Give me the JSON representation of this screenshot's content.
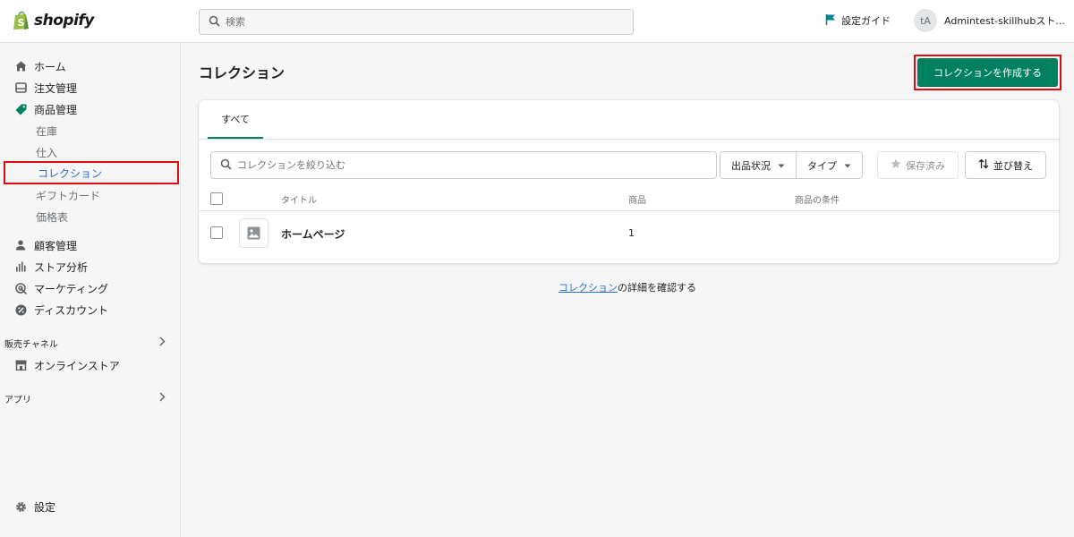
{
  "topbar": {
    "logo_text": "shopify",
    "search_placeholder": "検索",
    "setup_guide": "設定ガイド",
    "avatar_initials": "tA",
    "account_name": "Admintest-skillhubスト..."
  },
  "sidebar": {
    "items": [
      {
        "label": "ホーム",
        "icon": "home-icon"
      },
      {
        "label": "注文管理",
        "icon": "orders-icon"
      },
      {
        "label": "商品管理",
        "icon": "tag-icon"
      }
    ],
    "product_subitems": [
      "在庫",
      "仕入",
      "コレクション",
      "ギフトカード",
      "価格表"
    ],
    "active_subitem": "コレクション",
    "items2": [
      {
        "label": "顧客管理",
        "icon": "person-icon"
      },
      {
        "label": "ストア分析",
        "icon": "bar-chart-icon"
      },
      {
        "label": "マーケティング",
        "icon": "target-icon"
      },
      {
        "label": "ディスカウント",
        "icon": "discount-icon"
      }
    ],
    "sales_channel_label": "販売チャネル",
    "online_store": "オンラインストア",
    "apps_label": "アプリ",
    "settings": "設定"
  },
  "main": {
    "title": "コレクション",
    "create_button": "コレクションを作成する",
    "tabs": [
      {
        "label": "すべて"
      }
    ],
    "filter": {
      "search_placeholder": "コレクションを絞り込む",
      "status_filter": "出品状況",
      "type_filter": "タイプ",
      "saved": "保存済み",
      "sort": "並び替え"
    },
    "table": {
      "columns": [
        "タイトル",
        "商品",
        "商品の条件"
      ],
      "rows": [
        {
          "title": "ホームページ",
          "products": "1",
          "conditions": ""
        }
      ]
    },
    "help": {
      "link": "コレクション",
      "text": "の詳細を確認する"
    }
  },
  "colors": {
    "primary": "#008060",
    "highlight": "#e20a0a",
    "link": "#2c6ecb"
  }
}
